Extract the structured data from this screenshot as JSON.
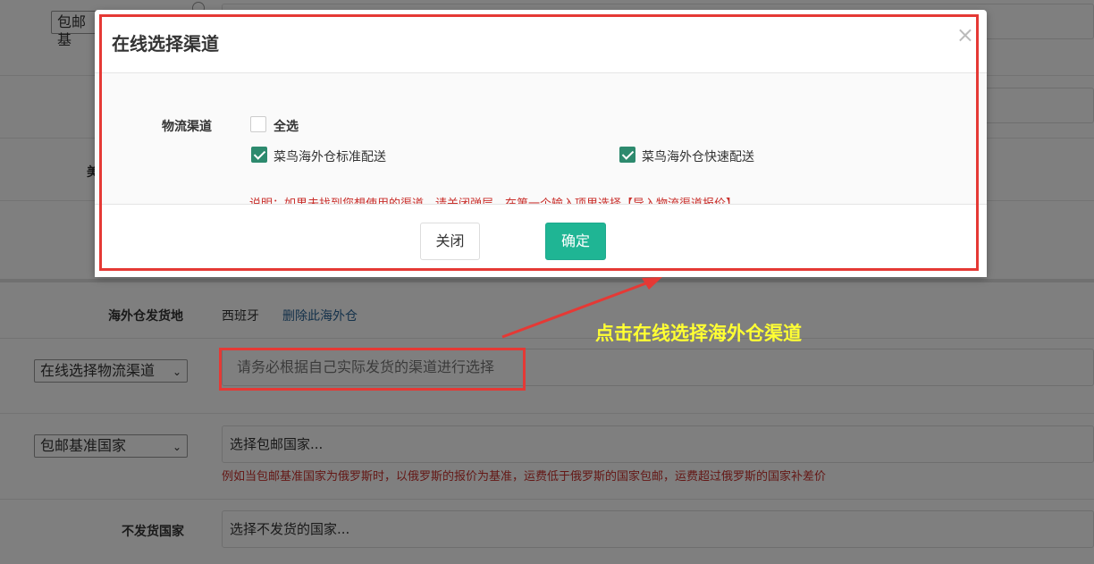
{
  "background": {
    "partial_select": "包邮基",
    "partial_label": "美",
    "warehouse_label": "海外仓发货地",
    "warehouse_value": "西班牙",
    "warehouse_delete_link": "删除此海外仓",
    "channel_select": "在线选择物流渠道",
    "channel_placeholder": "请务必根据自己实际发货的渠道进行选择",
    "country_select": "包邮基准国家",
    "country_placeholder": "选择包邮国家...",
    "country_hint": "例如当包邮基准国家为俄罗斯时，以俄罗斯的报价为基准，运费低于俄罗斯的国家包邮，运费超过俄罗斯的国家补差价",
    "no_ship_label": "不发货国家",
    "no_ship_placeholder": "选择不发货的国家..."
  },
  "modal": {
    "title": "在线选择渠道",
    "close_glyph": "×",
    "channel_label": "物流渠道",
    "select_all": "全选",
    "options": [
      {
        "label": "菜鸟海外仓标准配送",
        "checked": true
      },
      {
        "label": "菜鸟海外仓快速配送",
        "checked": true
      }
    ],
    "note": "说明：如果未找到您想使用的渠道，请关闭弹层，在第一个输入项里选择【导入物流渠道报价】",
    "close_button": "关闭",
    "confirm_button": "确定"
  },
  "annotation": {
    "text": "点击在线选择海外仓渠道",
    "color": "#ffff33",
    "box_color": "#e53935"
  },
  "icons": {
    "chevron": "chevron-down-icon",
    "check": "check-icon",
    "close": "close-icon",
    "radio": "radio-icon"
  }
}
